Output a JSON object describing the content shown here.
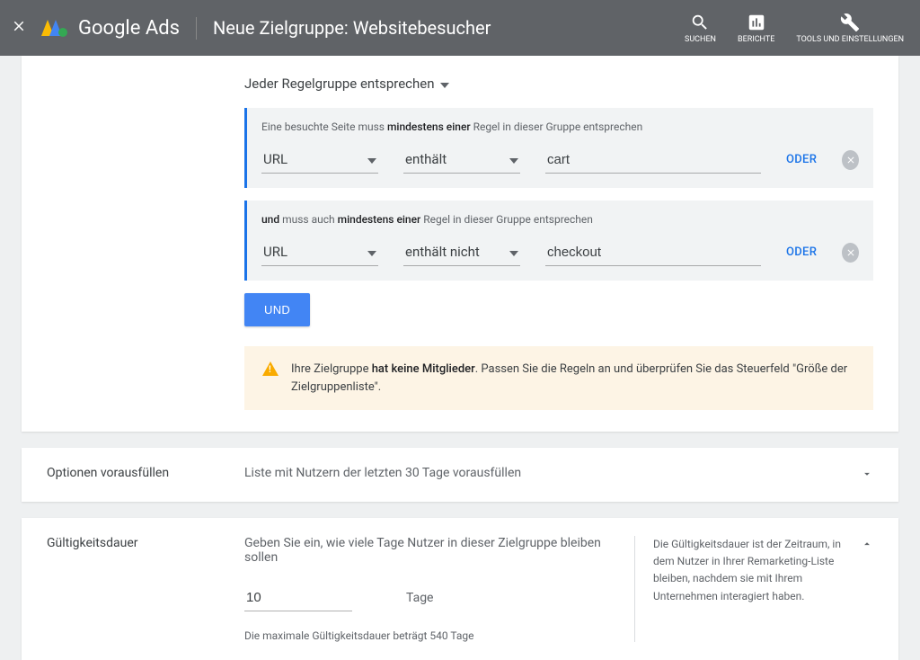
{
  "header": {
    "brand": "Google Ads",
    "page_title": "Neue Zielgruppe: Websitebesucher",
    "actions": {
      "search": "SUCHEN",
      "reports": "BERICHTE",
      "tools": "TOOLS UND EINSTELLUNGEN"
    }
  },
  "rules": {
    "match_mode": "Jeder Regelgruppe entsprechen",
    "groups": [
      {
        "hint_pre": "Eine besuchte Seite muss ",
        "hint_bold": "mindestens einer",
        "hint_post": " Regel in dieser Gruppe entsprechen",
        "field": "URL",
        "operator": "enthält",
        "value": "cart",
        "or_label": "ODER"
      },
      {
        "hint_pre": "und",
        "hint_mid": " muss auch ",
        "hint_bold": "mindestens einer",
        "hint_post": " Regel in dieser Gruppe entsprechen",
        "field": "URL",
        "operator": "enthält nicht",
        "value": "checkout",
        "or_label": "ODER"
      }
    ],
    "and_button": "UND",
    "warning_pre": "Ihre Zielgruppe ",
    "warning_bold": "hat keine Mitglieder",
    "warning_post": ". Passen Sie die Regeln an und überprüfen Sie das Steuerfeld \"Größe der Zielgruppenliste\"."
  },
  "prefill": {
    "label": "Optionen vorausfüllen",
    "value": "Liste mit Nutzern der letzten 30 Tage vorausfüllen"
  },
  "validity": {
    "label": "Gültigkeitsdauer",
    "prompt": "Geben Sie ein, wie viele Tage Nutzer in dieser Zielgruppe bleiben sollen",
    "days_value": "10",
    "days_unit": "Tage",
    "note": "Die maximale Gültigkeitsdauer beträgt 540 Tage",
    "help": "Die Gültigkeitsdauer ist der Zeitraum, in dem Nutzer in Ihrer Remarketing-Liste bleiben, nachdem sie mit Ihrem Unternehmen interagiert haben."
  }
}
